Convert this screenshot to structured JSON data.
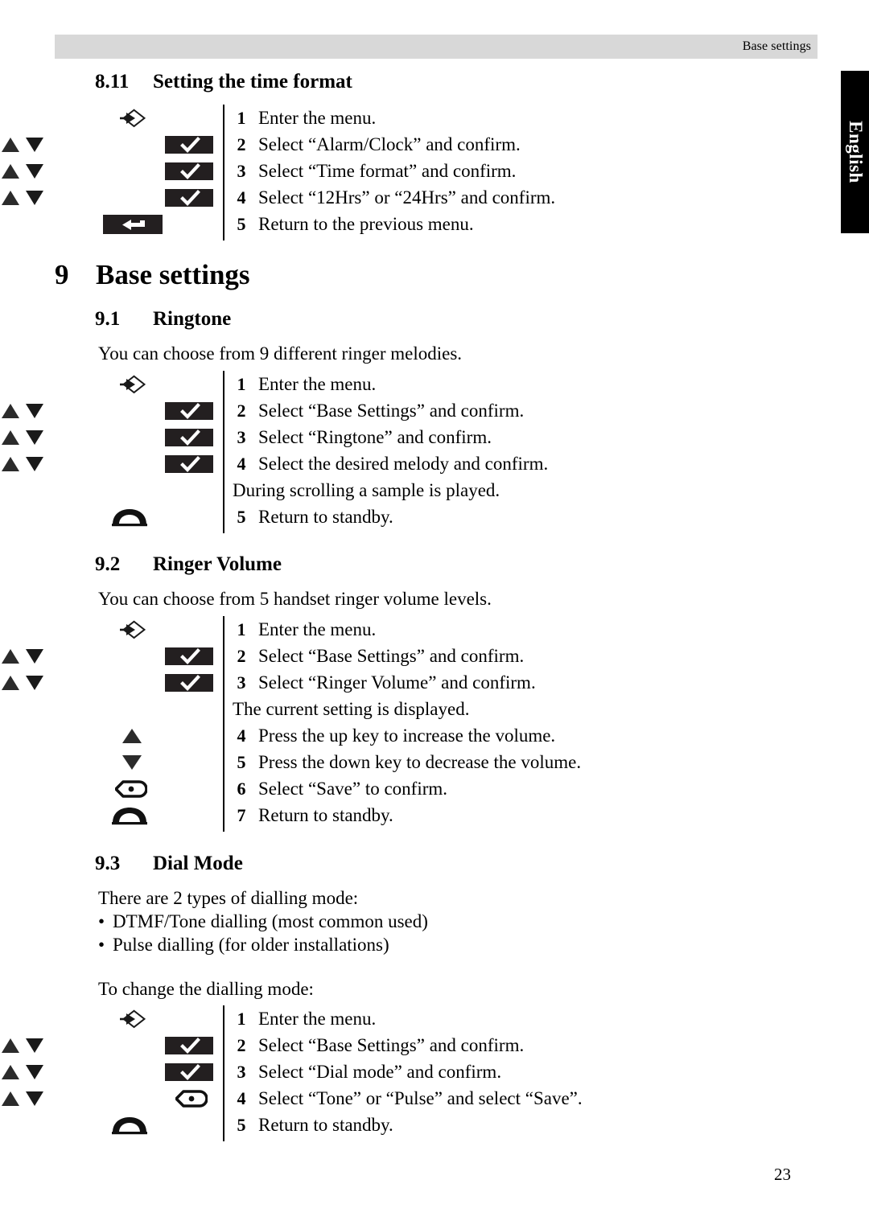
{
  "header": {
    "running_head": "Base settings"
  },
  "side_tab": {
    "label": "English"
  },
  "footer": {
    "page_number": "23"
  },
  "sections": {
    "s811": {
      "number": "8.11",
      "title": "Setting the time format",
      "steps": [
        {
          "n": "1",
          "text": "Enter the menu.",
          "icons": [
            "menu"
          ]
        },
        {
          "n": "2",
          "text": "Select “Alarm/Clock” and confirm.",
          "icons": [
            "updown",
            "ok"
          ]
        },
        {
          "n": "3",
          "text": "Select “Time format” and confirm.",
          "icons": [
            "updown",
            "ok"
          ]
        },
        {
          "n": "4",
          "text": "Select “12Hrs” or “24Hrs” and confirm.",
          "icons": [
            "updown",
            "ok"
          ]
        },
        {
          "n": "5",
          "text": "Return to the previous menu.",
          "icons": [
            "back"
          ]
        }
      ]
    },
    "s9": {
      "number": "9",
      "title": "Base settings"
    },
    "s91": {
      "number": "9.1",
      "title": "Ringtone",
      "intro": "You can choose from 9 different ringer melodies.",
      "steps": [
        {
          "n": "1",
          "text": "Enter the menu.",
          "icons": [
            "menu"
          ]
        },
        {
          "n": "2",
          "text": "Select “Base Settings” and confirm.",
          "icons": [
            "updown",
            "ok"
          ]
        },
        {
          "n": "3",
          "text": "Select “Ringtone” and confirm.",
          "icons": [
            "updown",
            "ok"
          ]
        },
        {
          "n": "4",
          "text": "Select the desired melody and confirm.",
          "icons": [
            "updown",
            "ok"
          ]
        },
        {
          "n": "",
          "text": "During scrolling a sample is played.",
          "icons": [],
          "note": true
        },
        {
          "n": "5",
          "text": "Return to standby.",
          "icons": [
            "hook"
          ]
        }
      ]
    },
    "s92": {
      "number": "9.2",
      "title": "Ringer Volume",
      "intro": "You can choose from 5 handset ringer volume levels.",
      "steps": [
        {
          "n": "1",
          "text": "Enter the menu.",
          "icons": [
            "menu"
          ]
        },
        {
          "n": "2",
          "text": "Select “Base Settings” and confirm.",
          "icons": [
            "updown",
            "ok"
          ]
        },
        {
          "n": "3",
          "text": "Select “Ringer Volume” and confirm.",
          "icons": [
            "updown",
            "ok"
          ]
        },
        {
          "n": "",
          "text": "The current setting is displayed.",
          "icons": [],
          "note": true
        },
        {
          "n": "4",
          "text": "Press the up key to increase the volume.",
          "icons": [
            "up"
          ]
        },
        {
          "n": "5",
          "text": "Press the down key to decrease the volume.",
          "icons": [
            "down"
          ]
        },
        {
          "n": "6",
          "text": "Select “Save” to confirm.",
          "icons": [
            "softL"
          ]
        },
        {
          "n": "7",
          "text": "Return to standby.",
          "icons": [
            "hook"
          ]
        }
      ]
    },
    "s93": {
      "number": "9.3",
      "title": "Dial Mode",
      "intro": "There are 2 types of dialling mode:",
      "bullets": [
        "DTMF/Tone dialling (most common used)",
        "Pulse dialling (for older installations)"
      ],
      "intro2": "To change the dialling mode:",
      "steps": [
        {
          "n": "1",
          "text": "Enter the menu.",
          "icons": [
            "menu"
          ]
        },
        {
          "n": "2",
          "text": "Select “Base Settings” and confirm.",
          "icons": [
            "updown",
            "ok"
          ]
        },
        {
          "n": "3",
          "text": "Select “Dial mode” and confirm.",
          "icons": [
            "updown",
            "ok"
          ]
        },
        {
          "n": "4",
          "text": "Select “Tone” or “Pulse” and select “Save”.",
          "icons": [
            "updown",
            "soft"
          ]
        },
        {
          "n": "5",
          "text": "Return to standby.",
          "icons": [
            "hook"
          ]
        }
      ]
    }
  },
  "bullet_char": "•",
  "colors": {
    "header_bg": "#d8d8d8",
    "tab_bg": "#000000",
    "text": "#000000",
    "page_bg": "#ffffff"
  },
  "icon_names": {
    "menu": "menu-enter-icon",
    "updown": "up-down-arrows-icon",
    "ok": "confirm-softkey-icon",
    "back": "return-softkey-icon",
    "hook": "hangup-handset-icon",
    "up": "up-arrow-icon",
    "down": "down-arrow-icon",
    "soft": "save-softkey-icon",
    "softL": "save-softkey-icon"
  }
}
